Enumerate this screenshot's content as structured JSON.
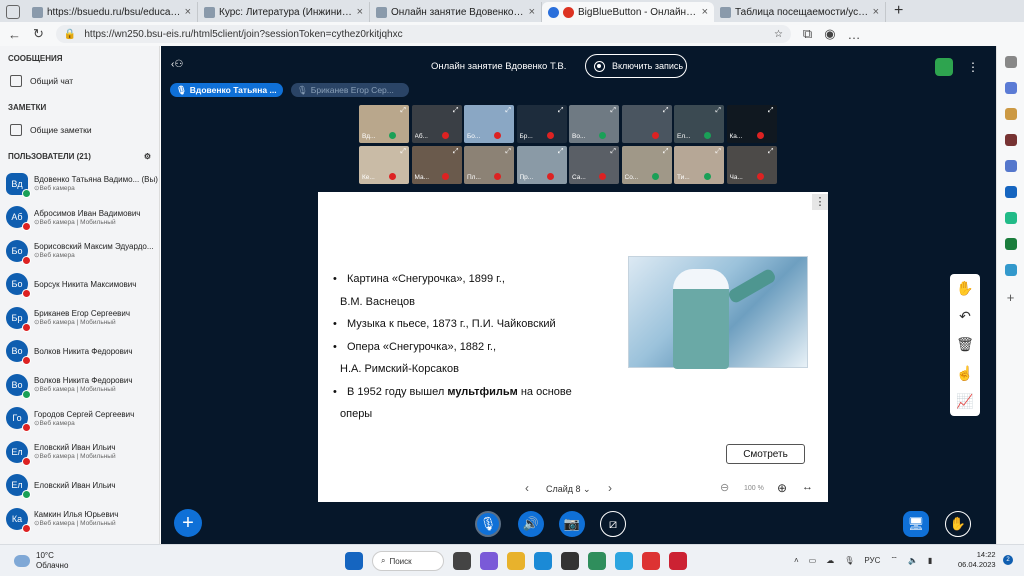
{
  "browser": {
    "tabs": [
      {
        "title": "https://bsuedu.ru/bsu/education",
        "fav": "doc"
      },
      {
        "title": "Курс: Литература (Инжиниринг",
        "fav": "doc"
      },
      {
        "title": "Онлайн занятие Вдовенко Т.В.",
        "fav": "doc"
      },
      {
        "title": "BigBlueButton - Онлайн зан",
        "fav": "bbb",
        "active": true
      },
      {
        "title": "Таблица посещаемости/успеваем",
        "fav": "doc"
      }
    ],
    "url": "https://wn250.bsu-eis.ru/html5client/join?sessionToken=cythez0rkitjqhxc"
  },
  "left": {
    "messages_header": "СООБЩЕНИЯ",
    "public_chat": "Общий чат",
    "notes_header": "ЗАМЕТКИ",
    "shared_notes": "Общие заметки",
    "users_header": "ПОЛЬЗОВАТЕЛИ (21)",
    "users": [
      {
        "initials": "Вд",
        "name": "Вдовенко Татьяна Вадимо... (Вы)",
        "sub": "Веб камера",
        "status": "#1aa057",
        "moderator": true
      },
      {
        "initials": "Аб",
        "name": "Абросимов Иван Вадимович",
        "sub": "Веб камера | Мобильный",
        "status": "#d22"
      },
      {
        "initials": "Бо",
        "name": "Борисовский Максим Эдуардо...",
        "sub": "Веб камера",
        "status": "#d22"
      },
      {
        "initials": "Бо",
        "name": "Борсук Никита Максимович",
        "sub": "",
        "status": "#d22"
      },
      {
        "initials": "Бр",
        "name": "Бриканев Егор Сергеевич",
        "sub": "Веб камера | Мобильный",
        "status": "#d22"
      },
      {
        "initials": "Во",
        "name": "Волков Никита Федорович",
        "sub": "",
        "status": "#d22"
      },
      {
        "initials": "Во",
        "name": "Волков Никита Федорович",
        "sub": "Веб камера | Мобильный",
        "status": "#1aa057"
      },
      {
        "initials": "Го",
        "name": "Городов Сергей Сергеевич",
        "sub": "Веб камера",
        "status": "#d22"
      },
      {
        "initials": "Ел",
        "name": "Еловский Иван Ильич",
        "sub": "Веб камера | Мобильный",
        "status": "#d22"
      },
      {
        "initials": "Ел",
        "name": "Еловский Иван Ильич",
        "sub": "",
        "status": "#1aa057"
      },
      {
        "initials": "Ка",
        "name": "Камкин Илья Юрьевич",
        "sub": "Веб камера | Мобильный",
        "status": "#d22"
      }
    ]
  },
  "main": {
    "title": "Онлайн занятие Вдовенко Т.В.",
    "record": "Включить запись",
    "talkers": [
      "Вдовенко Татьяна ...",
      "Бриканев Егор Сер..."
    ],
    "videos_row1": [
      {
        "n": "Вд...",
        "c": "#b9a78c",
        "m": "g"
      },
      {
        "n": "Аб...",
        "c": "#3a3f45",
        "m": "r"
      },
      {
        "n": "Бо...",
        "c": "#8aa7c4",
        "m": "r"
      },
      {
        "n": "Бр...",
        "c": "#1d2c3c",
        "m": "r"
      },
      {
        "n": "Во...",
        "c": "#6f7a83",
        "m": "g"
      },
      {
        "n": "",
        "c": "#4a5560",
        "m": "r"
      },
      {
        "n": "Ел...",
        "c": "#3b4a52",
        "m": "g"
      },
      {
        "n": "Ка...",
        "c": "#101820",
        "m": "r"
      }
    ],
    "videos_row2": [
      {
        "n": "Ке...",
        "c": "#c9bba6",
        "m": "r"
      },
      {
        "n": "Ма...",
        "c": "#6a5a4c",
        "m": "r"
      },
      {
        "n": "Пл...",
        "c": "#8c8275",
        "m": "r"
      },
      {
        "n": "Пр...",
        "c": "#8a9aa6",
        "m": "r"
      },
      {
        "n": "Са...",
        "c": "#5a5f66",
        "m": "r"
      },
      {
        "n": "Со...",
        "c": "#a09888",
        "m": "g"
      },
      {
        "n": "Ти...",
        "c": "#b6a796",
        "m": "g"
      },
      {
        "n": "Ча...",
        "c": "#4c4a48",
        "m": "r"
      }
    ]
  },
  "slide": {
    "b1a": "Картина «Снегурочка», 1899 г.,",
    "b1b": "В.М. Васнецов",
    "b2": "Музыка к пьесе, 1873 г., П.И. Чайковский",
    "b3a": "Опера «Снегурочка», 1882 г.,",
    "b3b": "Н.А. Римский-Корсаков",
    "b4a": "В 1952 году вышел ",
    "b4bold": "мультфильм",
    "b4b": " на основе",
    "b4c": "оперы",
    "watch": "Смотреть",
    "page": "Слайд 8",
    "zoom": "100 %"
  },
  "taskbar": {
    "temp": "10°C",
    "weather": "Облачно",
    "search": "Поиск",
    "lang": "РУС",
    "time": "14:22",
    "date": "06.04.2023",
    "notifications": "2"
  }
}
